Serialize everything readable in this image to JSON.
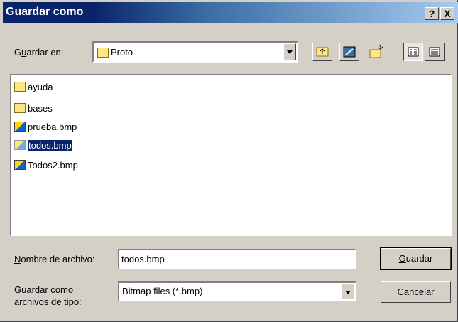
{
  "window": {
    "title": "Guardar como",
    "help_label": "?",
    "close_label": "X"
  },
  "location": {
    "label_pre": "G",
    "label_access": "u",
    "label_post": "ardar en:",
    "value": "Proto"
  },
  "files": [
    {
      "name": "ayuda",
      "type": "folder"
    },
    {
      "name": "bases",
      "type": "folder"
    },
    {
      "name": "prueba.bmp",
      "type": "bmp"
    },
    {
      "name": "todos.bmp",
      "type": "bmp",
      "selected": true
    },
    {
      "name": "Todos2.bmp",
      "type": "bmp"
    }
  ],
  "filename": {
    "label_access": "N",
    "label_post": "ombre de archivo:",
    "value": "todos.bmp"
  },
  "filetype": {
    "label_line1_pre": "Guardar c",
    "label_line1_access": "o",
    "label_line1_post": "mo",
    "label_line2": "archivos de tipo:",
    "value": "Bitmap files (*.bmp)"
  },
  "buttons": {
    "save_access": "G",
    "save_post": "uardar",
    "cancel": "Cancelar"
  },
  "colors": {
    "title_bar": "#0a246a",
    "selection": "#0a246a",
    "window_face": "#d4d0c8"
  }
}
